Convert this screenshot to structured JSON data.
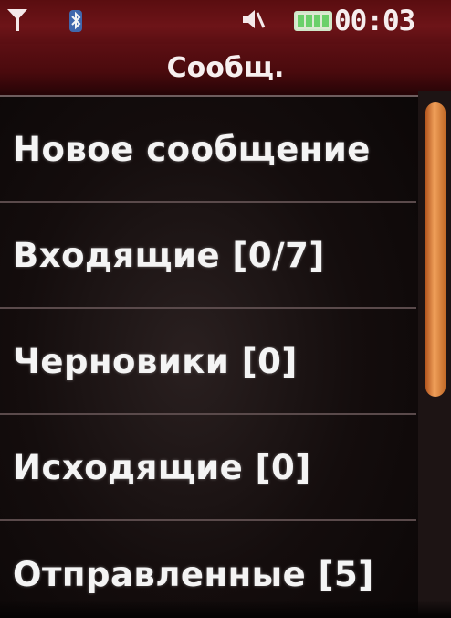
{
  "status_bar": {
    "icons": [
      "signal-icon",
      "bluetooth-icon",
      "silent-mode-icon",
      "battery-icon"
    ],
    "time": "00:03",
    "battery_level": 1.0
  },
  "title": "Сообщ.",
  "menu": {
    "items": [
      {
        "label": "Новое сообщение"
      },
      {
        "label": "Входящие [0/7]"
      },
      {
        "label": "Черновики [0]"
      },
      {
        "label": "Исходящие [0]"
      },
      {
        "label": "Отправленные [5]"
      }
    ]
  },
  "colors": {
    "header_bg": "#6d1418",
    "title_bg": "#4a0a0d",
    "text": "#f4f4f4",
    "scrollbar_thumb": "#f0a05a",
    "divider": "#5a4a4b"
  }
}
